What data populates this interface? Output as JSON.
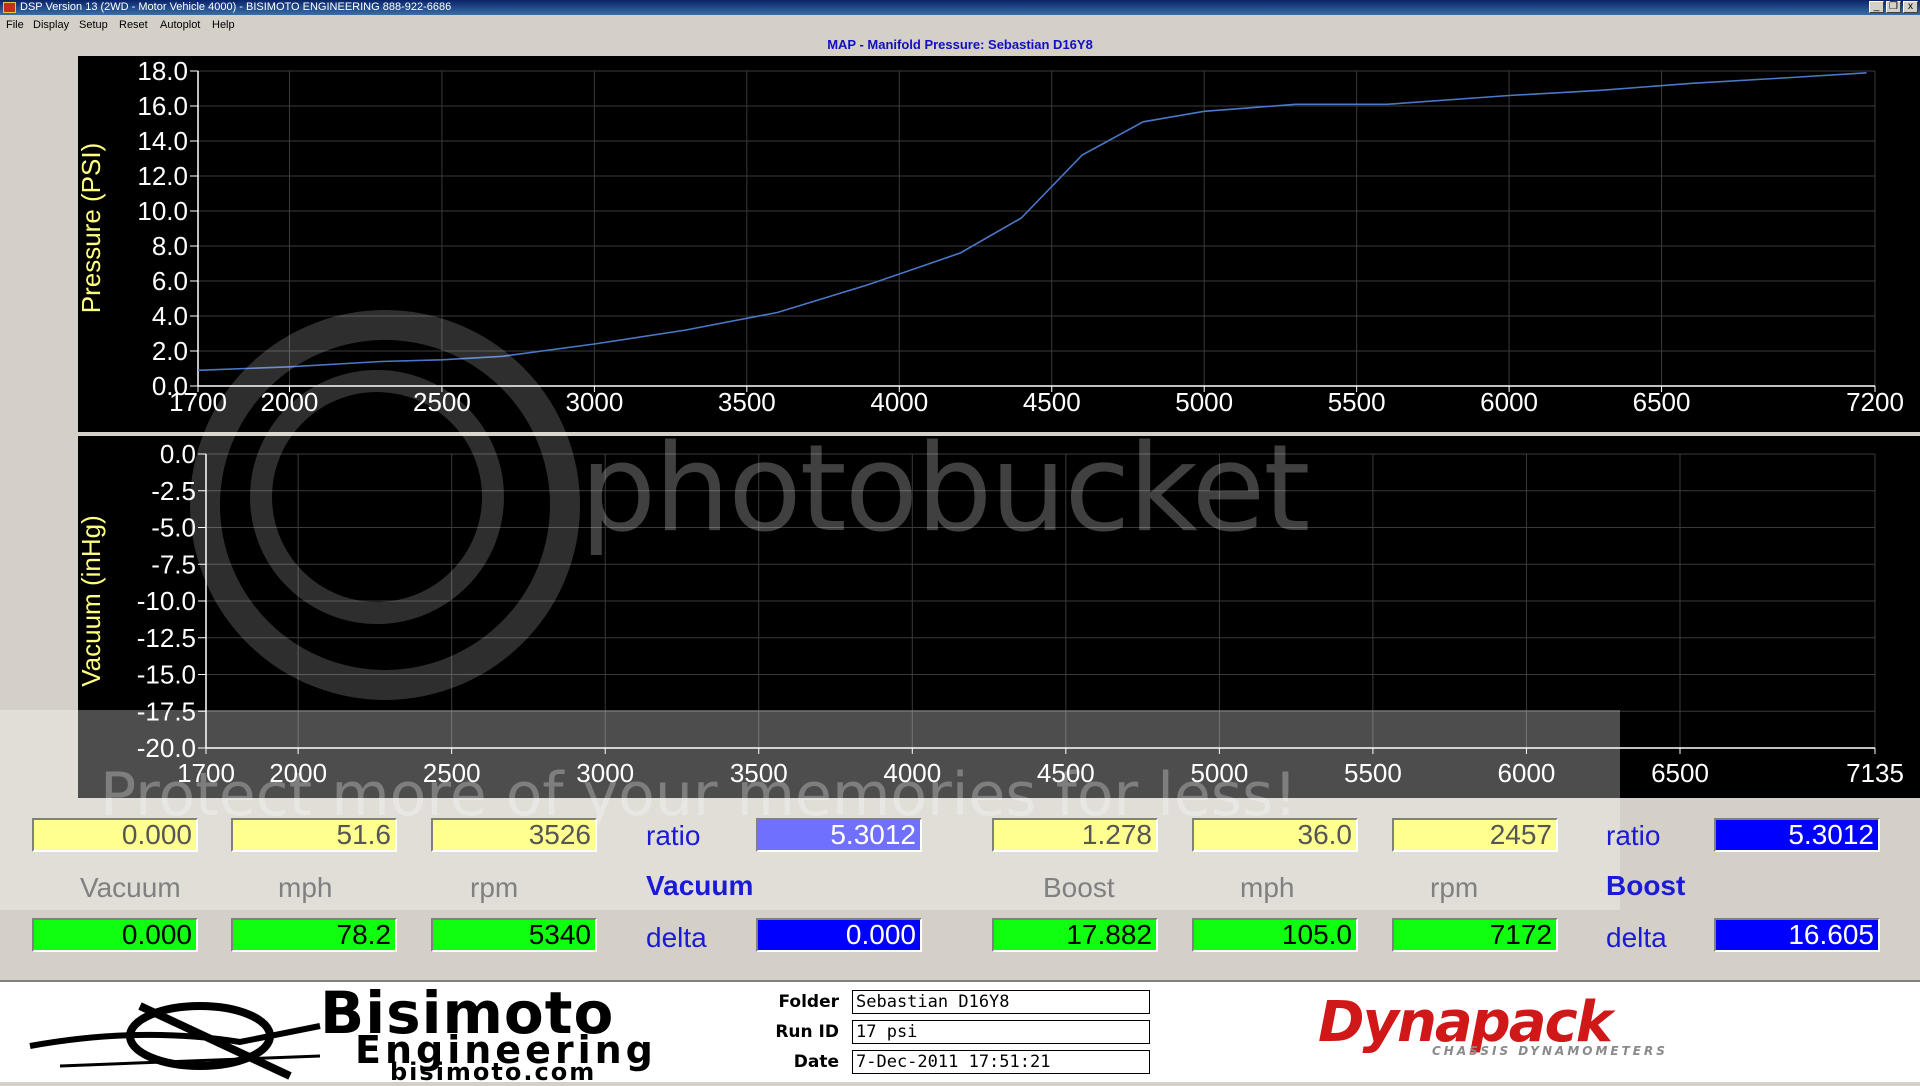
{
  "window": {
    "title": "DSP Version 13 (2WD - Motor Vehicle 4000) - BISIMOTO ENGINEERING 888-922-6686",
    "controls": [
      "_",
      "❐",
      "x"
    ]
  },
  "menu": [
    "File",
    "Display",
    "Setup",
    "Reset",
    "Autoplot",
    "Help"
  ],
  "chart_title": "MAP - Manifold Pressure: Sebastian D16Y8",
  "chart_data": [
    {
      "type": "line",
      "ylabel": "Pressure (PSI)",
      "xlim": [
        1700,
        7200
      ],
      "ylim": [
        0,
        18
      ],
      "xticks": [
        1700,
        2000,
        2500,
        3000,
        3500,
        4000,
        4500,
        5000,
        5500,
        6000,
        6500,
        7200
      ],
      "yticks": [
        "18.0",
        "16.0",
        "14.0",
        "12.0",
        "10.0",
        "8.0",
        "6.0",
        "4.0",
        "2.0",
        "0.0"
      ],
      "grid": true,
      "series": [
        {
          "color": "#4a78c8",
          "x": [
            1700,
            2000,
            2300,
            2500,
            2700,
            3000,
            3300,
            3600,
            3900,
            4200,
            4400,
            4600,
            4800,
            5000,
            5300,
            5600,
            6000,
            6300,
            6600,
            6900,
            7172
          ],
          "y": [
            0.9,
            1.1,
            1.4,
            1.5,
            1.7,
            2.4,
            3.2,
            4.2,
            5.8,
            7.6,
            9.6,
            13.2,
            15.1,
            15.7,
            16.1,
            16.1,
            16.6,
            16.9,
            17.3,
            17.6,
            17.9
          ]
        }
      ]
    },
    {
      "type": "line",
      "ylabel": "Vacuum (inHg)",
      "xlim": [
        1700,
        7135
      ],
      "ylim": [
        -20,
        0
      ],
      "xticks": [
        1700,
        2000,
        2500,
        3000,
        3500,
        4000,
        4500,
        5000,
        5500,
        6000,
        6500,
        7135
      ],
      "yticks": [
        "0.0",
        "-2.5",
        "-5.0",
        "-7.5",
        "-10.0",
        "-12.5",
        "-15.0",
        "-17.5",
        "-20.0"
      ],
      "grid": true,
      "series": []
    }
  ],
  "readouts": {
    "left": {
      "vacuum_yellow": "0.000",
      "mph_yellow": "51.6",
      "rpm_yellow": "3526",
      "ratio_label": "ratio",
      "ratio_value": "5.3012",
      "vacuum_label": "Vacuum",
      "mph_label": "mph",
      "rpm_label": "rpm",
      "mode_label": "Vacuum",
      "vacuum_green": "0.000",
      "mph_green": "78.2",
      "rpm_green": "5340",
      "delta_label": "delta",
      "delta_value": "0.000"
    },
    "right": {
      "boost_yellow": "1.278",
      "mph_yellow": "36.0",
      "rpm_yellow": "2457",
      "ratio_label": "ratio",
      "ratio_value": "5.3012",
      "boost_label": "Boost",
      "mph_label": "mph",
      "rpm_label": "rpm",
      "mode_label": "Boost",
      "boost_green": "17.882",
      "mph_green": "105.0",
      "rpm_green": "7172",
      "delta_label": "delta",
      "delta_value": "16.605"
    }
  },
  "footer": {
    "brand_big": "Bisimoto",
    "brand_sub": "Engineering",
    "brand_url": "bisimoto.com",
    "folder_label": "Folder",
    "folder_value": "Sebastian D16Y8",
    "runid_label": "Run ID",
    "runid_value": "17 psi",
    "date_label": "Date",
    "date_value": "7-Dec-2011 17:51:21",
    "dyno_brand": "Dynapack",
    "dyno_sub": "CHASSIS DYNAMOMETERS"
  },
  "watermark": {
    "brand": "photobucket",
    "banner": "Protect more of your memories for less!"
  }
}
